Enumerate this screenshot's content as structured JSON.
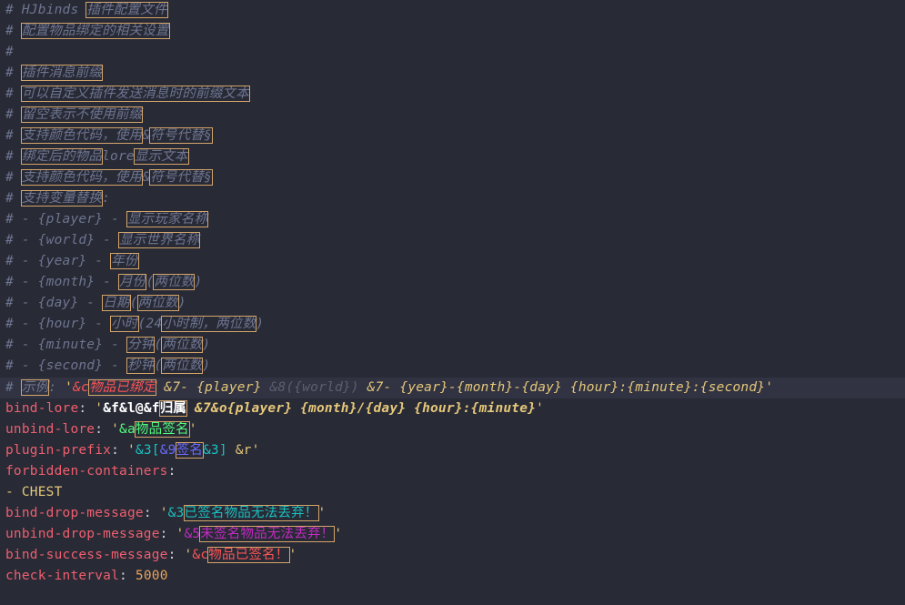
{
  "lines": [
    {
      "kind": "comment",
      "prefix": "# ",
      "a": "HJbinds ",
      "b": "插件配置文件"
    },
    {
      "kind": "comment",
      "prefix": "# ",
      "b": "配置物品绑定的相关设置"
    },
    {
      "kind": "comment",
      "prefix": "#"
    },
    {
      "kind": "comment",
      "prefix": "# ",
      "b": "插件消息前缀"
    },
    {
      "kind": "comment",
      "prefix": "# ",
      "b": "可以自定义插件发送消息时的前缀文本"
    },
    {
      "kind": "comment",
      "prefix": "# ",
      "b": "留空表示不使用前缀"
    },
    {
      "kind": "comment",
      "prefix": "# ",
      "b": "支持颜色代码，使用",
      "c": "&",
      "d": "符号代替§"
    },
    {
      "kind": "comment",
      "prefix": "# ",
      "b": "绑定后的物品",
      "c": "lore",
      "d": "显示文本"
    },
    {
      "kind": "comment",
      "prefix": "# ",
      "b": "支持颜色代码，使用",
      "c": "&",
      "d": "符号代替§"
    },
    {
      "kind": "comment",
      "prefix": "# ",
      "b": "支持变量替换",
      "c": ":"
    },
    {
      "kind": "comment",
      "prefix": "# - {player} - ",
      "b": "显示玩家名称"
    },
    {
      "kind": "comment",
      "prefix": "# - {world} - ",
      "b": "显示世界名称"
    },
    {
      "kind": "comment",
      "prefix": "# - {year} - ",
      "b": "年份"
    },
    {
      "kind": "comment",
      "prefix": "# - {month} - ",
      "b": "月份",
      "c": "(",
      "d": "两位数",
      "e": ")"
    },
    {
      "kind": "comment",
      "prefix": "# - {day} - ",
      "b": "日期",
      "c": "(",
      "d": "两位数",
      "e": ")"
    },
    {
      "kind": "comment",
      "prefix": "# - {hour} - ",
      "b": "小时",
      "c": "(24",
      "d": "小时制，两位数",
      "e": ")"
    },
    {
      "kind": "comment",
      "prefix": "# - {minute} - ",
      "b": "分钟",
      "c": "(",
      "d": "两位数",
      "e": ")"
    },
    {
      "kind": "comment",
      "prefix": "# - {second} - ",
      "b": "秒钟",
      "c": "(",
      "d": "两位数",
      "e": ")"
    }
  ],
  "example": {
    "prefix": "# ",
    "label": "示例",
    "colon": ": ",
    "q1": "'",
    "code_c": "&c",
    "bound": "物品已绑定",
    "rest1": " &7- {player} ",
    "rest2": "&8({world})",
    "rest3": " &7- {year}-{month}-{day} {hour}:{minute}:{second}",
    "q2": "'"
  },
  "bind_lore": {
    "key": "bind-lore",
    "colon": ": ",
    "q1": "'",
    "codes": "&f&l@&f",
    "owner": "归属",
    "rest": " &7&o{player} {month}/{day} {hour}:{minute}",
    "q2": "'"
  },
  "unbind_lore": {
    "key": "unbind-lore",
    "colon": ": ",
    "q1": "'",
    "code": "&a",
    "text": "物品签名",
    "q2": "'"
  },
  "plugin_prefix": {
    "key": "plugin-prefix",
    "colon": ": ",
    "q1": "'",
    "code1": "&3[",
    "code2": "&9",
    "text": "签名",
    "code3": "&3]",
    "rest": " &r",
    "q2": "'"
  },
  "forbidden": {
    "key": "forbidden-containers",
    "colon": ":",
    "item": "- CHEST"
  },
  "bind_drop": {
    "key": "bind-drop-message",
    "colon": ": ",
    "q1": "'",
    "code": "&3",
    "text": "已签名物品无法丢弃！",
    "q2": "'"
  },
  "unbind_drop": {
    "key": "unbind-drop-message",
    "colon": ": ",
    "q1": "'",
    "code": "&5",
    "text": "未签名物品无法丢弃！",
    "q2": "'"
  },
  "bind_success": {
    "key": "bind-success-message",
    "colon": ": ",
    "q1": "'",
    "code": "&c",
    "text": "物品已签名！",
    "q2": "'"
  },
  "check_interval": {
    "key": "check-interval",
    "colon": ": ",
    "value": "5000"
  }
}
